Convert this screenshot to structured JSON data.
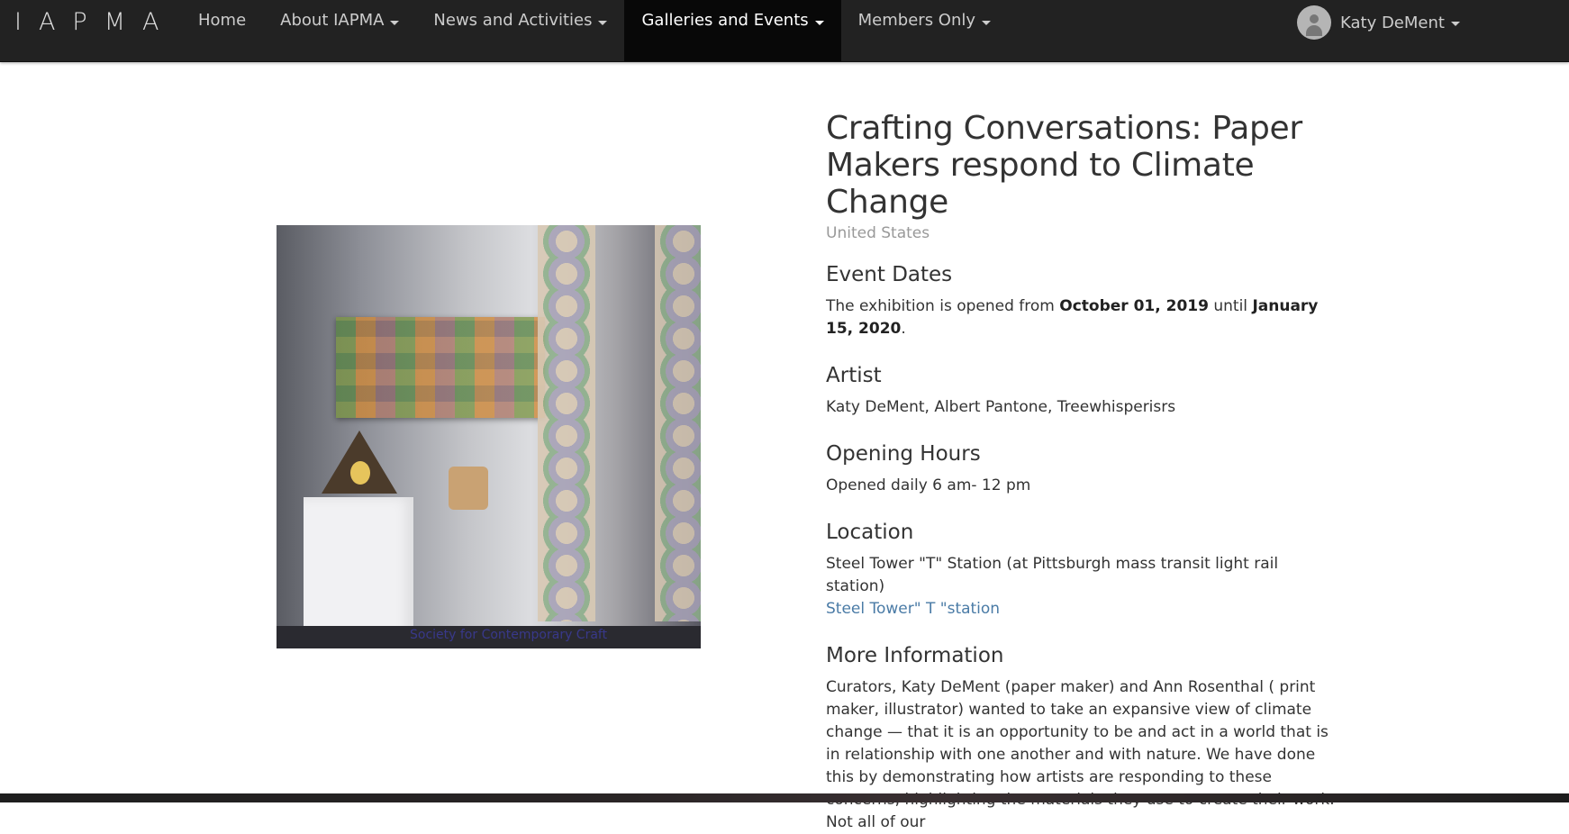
{
  "nav": {
    "brand": "IAPMA",
    "items": [
      {
        "label": "Home",
        "dropdown": false,
        "active": false
      },
      {
        "label": "About IAPMA",
        "dropdown": true,
        "active": false
      },
      {
        "label": "News and Activities",
        "dropdown": true,
        "active": false
      },
      {
        "label": "Galleries and Events",
        "dropdown": true,
        "active": true
      },
      {
        "label": "Members Only",
        "dropdown": true,
        "active": false
      }
    ],
    "user": {
      "name": "Katy DeMent",
      "avatar_icon": "user-avatar-icon"
    }
  },
  "event": {
    "title": "Crafting Conversations: Paper Makers respond to Climate Change",
    "country": "United States",
    "dates_heading": "Event Dates",
    "dates_prefix": "The exhibition is opened from",
    "date_start": "October 01, 2019",
    "dates_mid": "until",
    "date_end": "January 15, 2020",
    "dates_suffix": ".",
    "artist_heading": "Artist",
    "artists": "Katy DeMent, Albert Pantone, Treewhisperisrs",
    "hours_heading": "Opening Hours",
    "hours": "Opened daily 6 am- 12 pm",
    "location_heading": "Location",
    "location": "Steel Tower \"T\" Station (at Pittsburgh mass transit light rail station)",
    "location_link": "Steel Tower\" T \"station",
    "more_heading": "More Information",
    "more_text": "Curators, Katy DeMent (paper maker) and Ann Rosenthal ( print maker, illustrator) wanted to take an expansive view of climate change — that it is an opportunity to be and act in a world that is in relationship with one another and with nature. We have done this by demonstrating how artists are responding to these concerns, highlighting the materials they use to create their work. Not all of our"
  },
  "photo": {
    "watermark": "Society for Contemporary Craft"
  },
  "colors": {
    "navbar": "#222222",
    "nav_active": "#080808",
    "link": "#4a7ba6",
    "muted": "#999999"
  }
}
